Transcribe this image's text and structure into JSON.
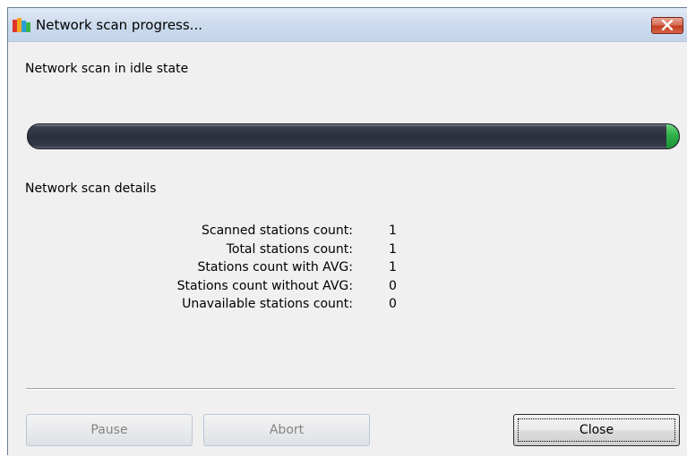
{
  "window": {
    "title": "Network scan progress...",
    "app_icon": "avg-logo-icon",
    "close_icon": "close-icon"
  },
  "scan": {
    "status_text": "Network scan in idle state",
    "progress_percent": 100,
    "details_label": "Network scan details"
  },
  "stats": [
    {
      "label": "Scanned stations count:",
      "value": "1"
    },
    {
      "label": "Total stations count:",
      "value": "1"
    },
    {
      "label": "Stations count with AVG:",
      "value": "1"
    },
    {
      "label": "Stations count without AVG:",
      "value": "0"
    },
    {
      "label": "Unavailable stations count:",
      "value": "0"
    }
  ],
  "buttons": {
    "pause_label": "Pause",
    "abort_label": "Abort",
    "close_label": "Close"
  },
  "colors": {
    "progress_bar": "#2a2f3b",
    "progress_fill": "#2fb049",
    "close_button_title": "#c23d20"
  }
}
